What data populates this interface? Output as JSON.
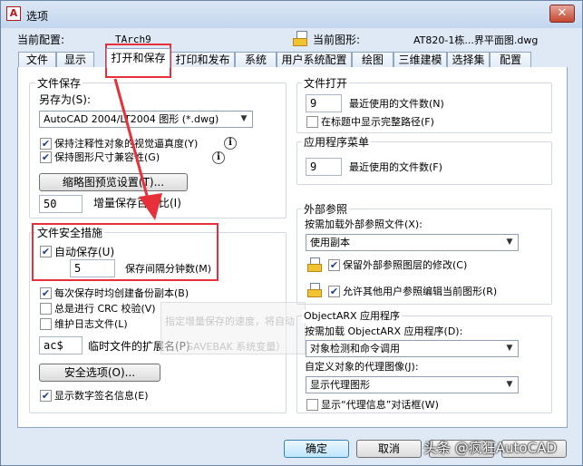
{
  "window": {
    "title": "选项",
    "close_label": "✕",
    "app_icon": "A"
  },
  "config": {
    "label": "当前配置:",
    "value": "TArch9"
  },
  "drawing": {
    "label": "当前图形:",
    "value": "AT820-1栋...界平面图.dwg",
    "icon": "drawing-file-icon"
  },
  "tabs": [
    {
      "label": "文件"
    },
    {
      "label": "显示"
    },
    {
      "label": "打开和保存",
      "active": true
    },
    {
      "label": "打印和发布"
    },
    {
      "label": "系统"
    },
    {
      "label": "用户系统配置"
    },
    {
      "label": "绘图"
    },
    {
      "label": "三维建模"
    },
    {
      "label": "选择集"
    },
    {
      "label": "配置"
    }
  ],
  "file_save": {
    "title": "文件保存",
    "save_as_label": "另存为(S):",
    "save_as_value": "AutoCAD 2004/LT2004 图形 (*.dwg)",
    "maintain_visual_fidelity": {
      "label": "保持注释性对象的视觉逼真度(Y)",
      "checked": true
    },
    "maintain_drawing_size": {
      "label": "保持图形尺寸兼容性(G)",
      "checked": true
    },
    "thumbnail_button": "缩略图预览设置(T)...",
    "incremental_value": "50",
    "incremental_label": "增量保存百分比(I)"
  },
  "file_safety": {
    "title": "文件安全措施",
    "autosave": {
      "label": "自动保存(U)",
      "checked": true
    },
    "interval_value": "5",
    "interval_label": "保存间隔分钟数(M)",
    "backup_copy": {
      "label": "每次保存时均创建备份副本(B)",
      "checked": true
    },
    "crc_check": {
      "label": "总是进行 CRC 校验(V)",
      "checked": false
    },
    "log_file": {
      "label": "维护日志文件(L)",
      "checked": false
    },
    "temp_ext_value": "ac$",
    "temp_ext_label": "临时文件的扩展名(P)",
    "security_button": "安全选项(O)...",
    "digital_signature": {
      "label": "显示数字签名信息(E)",
      "checked": true
    }
  },
  "file_open": {
    "title": "文件打开",
    "recent_value": "9",
    "recent_label": "最近使用的文件数(N)",
    "full_path": {
      "label": "在标题中显示完整路径(F)",
      "checked": false
    }
  },
  "app_menu": {
    "title": "应用程序菜单",
    "recent_value": "9",
    "recent_label": "最近使用的文件数(F)"
  },
  "xref": {
    "title": "外部参照",
    "demand_load_label": "按需加载外部参照文件(X):",
    "demand_load_value": "使用副本",
    "retain_layer": {
      "label": "保留外部参照图层的修改(C)",
      "checked": true
    },
    "allow_edit": {
      "label": "允许其他用户参照编辑当前图形(R)",
      "checked": true
    }
  },
  "objectarx": {
    "title": "ObjectARX 应用程序",
    "demand_load_label": "按需加载 ObjectARX 应用程序(D):",
    "demand_load_value": "对象检测和命令调用",
    "proxy_images_label": "自定义对象的代理图像(J):",
    "proxy_images_value": "显示代理图形",
    "proxy_info": {
      "label": "显示“代理信息”对话框(W)",
      "checked": false
    }
  },
  "footer": {
    "ok": "确定",
    "cancel": "取消"
  },
  "watermark": {
    "text": "头条 @疯狂AutoCAD"
  },
  "ghost_text": {
    "line1": "指定增量保存的速度，将自动",
    "line2": "SAVEBAK 系统变量）"
  },
  "colors": {
    "highlight": "#e8303a",
    "accent": "#1f3e8a"
  }
}
